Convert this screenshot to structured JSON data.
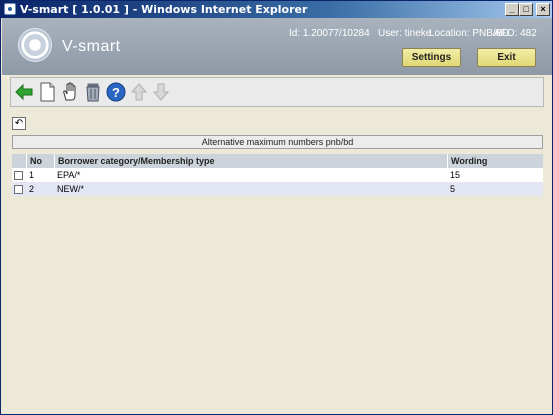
{
  "window": {
    "title": "V-smart [ 1.0.01 ] - Windows Internet Explorer"
  },
  "header": {
    "logo_text": "V-smart",
    "id_text": "Id: 1.20077/10284",
    "user_text": "User: tineke",
    "location_text": "Location: PNB/BD",
    "afo_text": "AFO: 482",
    "settings_label": "Settings",
    "exit_label": "Exit"
  },
  "toolbar": {
    "icons": [
      "back-arrow-icon",
      "new-document-icon",
      "select-hand-icon",
      "delete-trash-icon",
      "help-icon",
      "move-up-icon",
      "move-down-icon"
    ]
  },
  "caption": "Alternative maximum numbers pnb/bd",
  "table": {
    "columns": [
      "No",
      "Borrower category/Membership type",
      "Wording"
    ],
    "rows": [
      {
        "no": "1",
        "category": "EPA/*",
        "wording": "15"
      },
      {
        "no": "2",
        "category": "NEW/*",
        "wording": "5"
      }
    ]
  },
  "colors": {
    "title_bar": "#0a246a",
    "header_bg": "#9aa4b0",
    "button_bg": "#e9e28e",
    "row_alt": "#e3e7f4",
    "table_header": "#cdd3da"
  }
}
